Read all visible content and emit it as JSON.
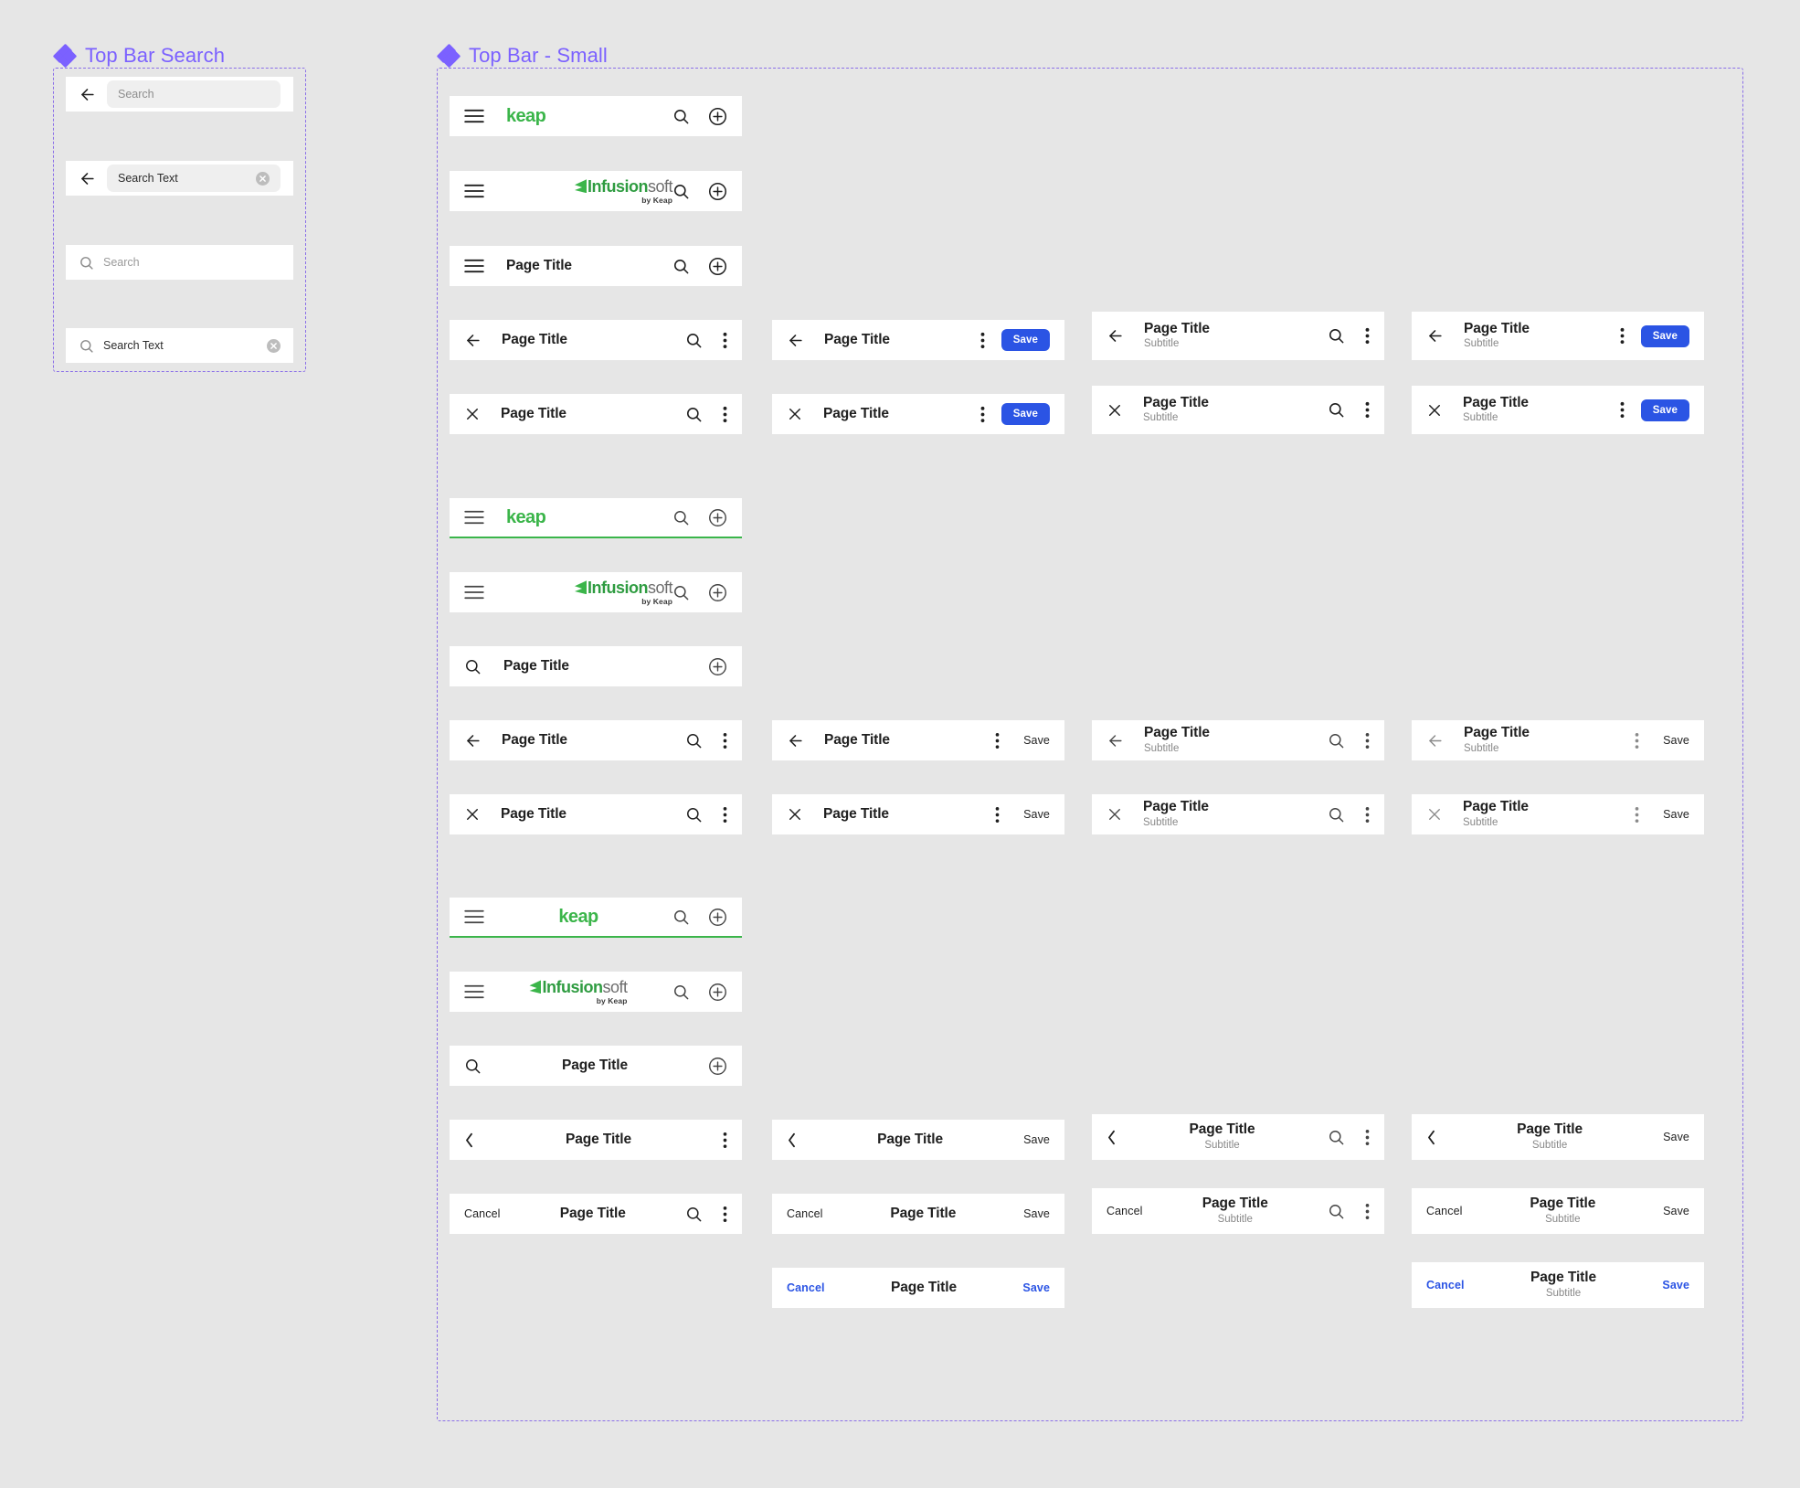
{
  "sections": {
    "search": {
      "title": "Top Bar Search"
    },
    "small": {
      "title": "Top Bar - Small"
    }
  },
  "labels": {
    "page_title": "Page Title",
    "subtitle": "Subtitle",
    "save": "Save",
    "cancel": "Cancel",
    "search_placeholder": "Search",
    "search_value": "Search Text",
    "keap": "keap",
    "infusion_1": "Infusion",
    "infusion_2": "soft",
    "infusion_by": "by Keap"
  },
  "colors": {
    "accent_purple": "#7b61ff",
    "brand_green": "#3bb54a",
    "save_blue": "#2b54e4",
    "canvas": "#e6e6e6",
    "bar": "#ffffff",
    "subtitle_gray": "#888888"
  },
  "search_bars": [
    {
      "name": "back-pill-placeholder",
      "leading": "arrow-back-icon",
      "field": "pill",
      "text": "Search",
      "state": "placeholder",
      "clear": false
    },
    {
      "name": "back-pill-value",
      "leading": "arrow-back-icon",
      "field": "pill",
      "text": "Search Text",
      "state": "value",
      "clear": true
    },
    {
      "name": "inline-placeholder",
      "leading": "search-icon",
      "field": "plain",
      "text": "Search",
      "state": "placeholder",
      "clear": false
    },
    {
      "name": "inline-value",
      "leading": "search-icon",
      "field": "plain",
      "text": "Search Text",
      "state": "value",
      "clear": true
    }
  ],
  "icon_names": {
    "menu": "hamburger-menu-icon",
    "search": "search-icon",
    "add": "add-circle-icon",
    "back": "arrow-back-icon",
    "close": "close-icon",
    "chevron": "chevron-left-icon",
    "more": "more-vertical-icon",
    "clear": "clear-circle-icon"
  }
}
